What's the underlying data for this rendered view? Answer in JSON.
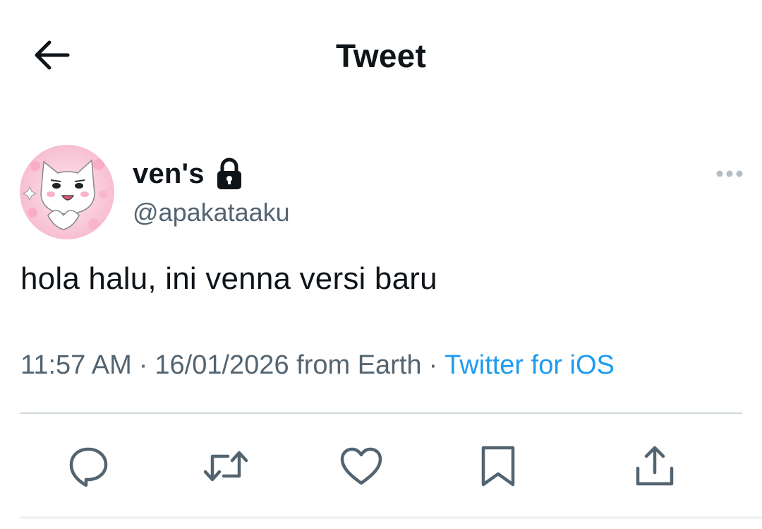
{
  "header": {
    "back_icon": "arrow-left-icon",
    "title": "Tweet"
  },
  "tweet": {
    "author": {
      "display_name": "ven's",
      "handle": "@apakataaku",
      "protected_icon": "lock-icon",
      "avatar_icon": "cat-avatar"
    },
    "more_icon": "more-horizontal-icon",
    "text": "hola halu, ini venna versi baru",
    "meta": {
      "time": "11:57 AM",
      "separator": "·",
      "date_location": "16/01/2026 from Earth",
      "source": "Twitter for iOS"
    },
    "actions": [
      {
        "name": "reply",
        "icon": "reply-icon"
      },
      {
        "name": "retweet",
        "icon": "retweet-icon"
      },
      {
        "name": "like",
        "icon": "heart-icon"
      },
      {
        "name": "bookmark",
        "icon": "bookmark-icon"
      },
      {
        "name": "share",
        "icon": "share-icon"
      }
    ]
  },
  "colors": {
    "text_primary": "#0f1419",
    "text_secondary": "#536471",
    "link": "#1d9bf0",
    "divider": "#cfd9de",
    "avatar_bg": "#f9c6d6"
  }
}
